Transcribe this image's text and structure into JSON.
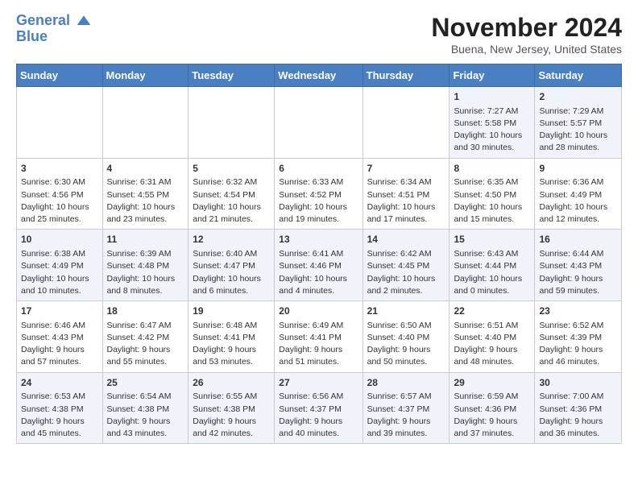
{
  "logo": {
    "line1": "General",
    "line2": "Blue"
  },
  "header": {
    "month": "November 2024",
    "location": "Buena, New Jersey, United States"
  },
  "weekdays": [
    "Sunday",
    "Monday",
    "Tuesday",
    "Wednesday",
    "Thursday",
    "Friday",
    "Saturday"
  ],
  "weeks": [
    [
      {
        "day": "",
        "info": ""
      },
      {
        "day": "",
        "info": ""
      },
      {
        "day": "",
        "info": ""
      },
      {
        "day": "",
        "info": ""
      },
      {
        "day": "",
        "info": ""
      },
      {
        "day": "1",
        "info": "Sunrise: 7:27 AM\nSunset: 5:58 PM\nDaylight: 10 hours\nand 30 minutes."
      },
      {
        "day": "2",
        "info": "Sunrise: 7:29 AM\nSunset: 5:57 PM\nDaylight: 10 hours\nand 28 minutes."
      }
    ],
    [
      {
        "day": "3",
        "info": "Sunrise: 6:30 AM\nSunset: 4:56 PM\nDaylight: 10 hours\nand 25 minutes."
      },
      {
        "day": "4",
        "info": "Sunrise: 6:31 AM\nSunset: 4:55 PM\nDaylight: 10 hours\nand 23 minutes."
      },
      {
        "day": "5",
        "info": "Sunrise: 6:32 AM\nSunset: 4:54 PM\nDaylight: 10 hours\nand 21 minutes."
      },
      {
        "day": "6",
        "info": "Sunrise: 6:33 AM\nSunset: 4:52 PM\nDaylight: 10 hours\nand 19 minutes."
      },
      {
        "day": "7",
        "info": "Sunrise: 6:34 AM\nSunset: 4:51 PM\nDaylight: 10 hours\nand 17 minutes."
      },
      {
        "day": "8",
        "info": "Sunrise: 6:35 AM\nSunset: 4:50 PM\nDaylight: 10 hours\nand 15 minutes."
      },
      {
        "day": "9",
        "info": "Sunrise: 6:36 AM\nSunset: 4:49 PM\nDaylight: 10 hours\nand 12 minutes."
      }
    ],
    [
      {
        "day": "10",
        "info": "Sunrise: 6:38 AM\nSunset: 4:49 PM\nDaylight: 10 hours\nand 10 minutes."
      },
      {
        "day": "11",
        "info": "Sunrise: 6:39 AM\nSunset: 4:48 PM\nDaylight: 10 hours\nand 8 minutes."
      },
      {
        "day": "12",
        "info": "Sunrise: 6:40 AM\nSunset: 4:47 PM\nDaylight: 10 hours\nand 6 minutes."
      },
      {
        "day": "13",
        "info": "Sunrise: 6:41 AM\nSunset: 4:46 PM\nDaylight: 10 hours\nand 4 minutes."
      },
      {
        "day": "14",
        "info": "Sunrise: 6:42 AM\nSunset: 4:45 PM\nDaylight: 10 hours\nand 2 minutes."
      },
      {
        "day": "15",
        "info": "Sunrise: 6:43 AM\nSunset: 4:44 PM\nDaylight: 10 hours\nand 0 minutes."
      },
      {
        "day": "16",
        "info": "Sunrise: 6:44 AM\nSunset: 4:43 PM\nDaylight: 9 hours\nand 59 minutes."
      }
    ],
    [
      {
        "day": "17",
        "info": "Sunrise: 6:46 AM\nSunset: 4:43 PM\nDaylight: 9 hours\nand 57 minutes."
      },
      {
        "day": "18",
        "info": "Sunrise: 6:47 AM\nSunset: 4:42 PM\nDaylight: 9 hours\nand 55 minutes."
      },
      {
        "day": "19",
        "info": "Sunrise: 6:48 AM\nSunset: 4:41 PM\nDaylight: 9 hours\nand 53 minutes."
      },
      {
        "day": "20",
        "info": "Sunrise: 6:49 AM\nSunset: 4:41 PM\nDaylight: 9 hours\nand 51 minutes."
      },
      {
        "day": "21",
        "info": "Sunrise: 6:50 AM\nSunset: 4:40 PM\nDaylight: 9 hours\nand 50 minutes."
      },
      {
        "day": "22",
        "info": "Sunrise: 6:51 AM\nSunset: 4:40 PM\nDaylight: 9 hours\nand 48 minutes."
      },
      {
        "day": "23",
        "info": "Sunrise: 6:52 AM\nSunset: 4:39 PM\nDaylight: 9 hours\nand 46 minutes."
      }
    ],
    [
      {
        "day": "24",
        "info": "Sunrise: 6:53 AM\nSunset: 4:38 PM\nDaylight: 9 hours\nand 45 minutes."
      },
      {
        "day": "25",
        "info": "Sunrise: 6:54 AM\nSunset: 4:38 PM\nDaylight: 9 hours\nand 43 minutes."
      },
      {
        "day": "26",
        "info": "Sunrise: 6:55 AM\nSunset: 4:38 PM\nDaylight: 9 hours\nand 42 minutes."
      },
      {
        "day": "27",
        "info": "Sunrise: 6:56 AM\nSunset: 4:37 PM\nDaylight: 9 hours\nand 40 minutes."
      },
      {
        "day": "28",
        "info": "Sunrise: 6:57 AM\nSunset: 4:37 PM\nDaylight: 9 hours\nand 39 minutes."
      },
      {
        "day": "29",
        "info": "Sunrise: 6:59 AM\nSunset: 4:36 PM\nDaylight: 9 hours\nand 37 minutes."
      },
      {
        "day": "30",
        "info": "Sunrise: 7:00 AM\nSunset: 4:36 PM\nDaylight: 9 hours\nand 36 minutes."
      }
    ]
  ]
}
